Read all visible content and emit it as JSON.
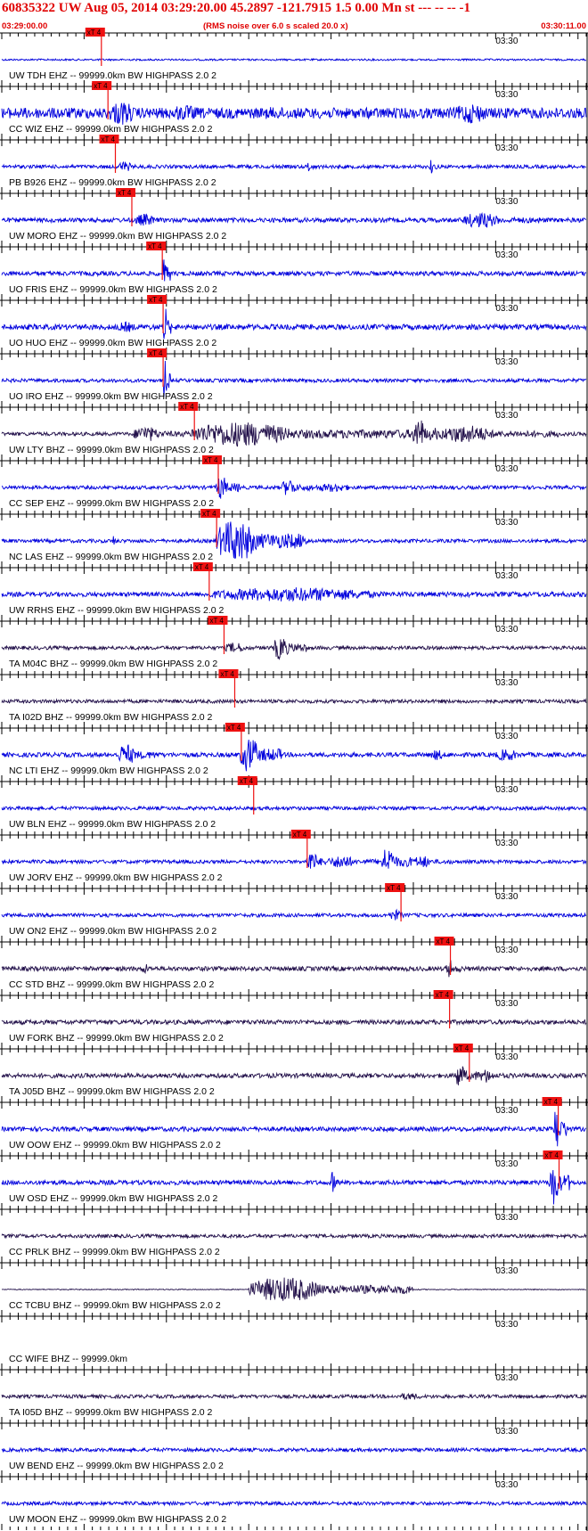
{
  "header": {
    "title": "60835322 UW Aug 05, 2014 03:29:20.00   45.2897 -121.7915  1.5 0.00 Mn st --- -- --   -1",
    "start_time": "03:29:00.00",
    "subtitle": "(RMS noise over 6.0 s scaled 20.0 x)",
    "end_time": "03:30:11.00"
  },
  "chart_data": {
    "type": "seismogram",
    "time_start_s": 0,
    "time_end_s": 71,
    "time_axis_label": "03:30",
    "time_axis_label_at_s": 60,
    "pick_label": "xT 4",
    "colors": {
      "blue": "#0000dd",
      "dark": "#22104a",
      "pick": "#ee1111"
    },
    "traces": [
      {
        "label": "UW TDH EHZ -- 99999.0km BW  HIGHPASS  2.0  2",
        "pick_s": 12.1,
        "color": "blue",
        "amp": 1,
        "bursts": []
      },
      {
        "label": "CC WIZ EHZ -- 99999.0km BW  HIGHPASS  2.0  2",
        "pick_s": 12.9,
        "color": "blue",
        "amp": 6,
        "bursts": [
          [
            13,
            20,
            14
          ],
          [
            20,
            30,
            9
          ],
          [
            30,
            45,
            7
          ],
          [
            55,
            64,
            12
          ]
        ]
      },
      {
        "label": "PB B926 EHZ -- 99999.0km BW  HIGHPASS  2.0  2",
        "pick_s": 13.8,
        "color": "blue",
        "amp": 2,
        "bursts": [
          [
            14,
            18,
            6
          ],
          [
            37,
            38,
            8
          ],
          [
            52,
            53,
            9
          ]
        ]
      },
      {
        "label": "UW MORO EHZ -- 99999.0km BW  HIGHPASS  2.0  2",
        "pick_s": 15.8,
        "color": "blue",
        "amp": 2.5,
        "bursts": [
          [
            16,
            22,
            7
          ],
          [
            56,
            66,
            9
          ]
        ]
      },
      {
        "label": "UO FRIS EHZ -- 99999.0km BW  HIGHPASS  2.0  2",
        "pick_s": 19.5,
        "color": "blue",
        "amp": 2.5,
        "bursts": [
          [
            19.5,
            20.5,
            24
          ]
        ]
      },
      {
        "label": "UO HUO EHZ -- 99999.0km BW  HIGHPASS  2.0  2",
        "pick_s": 19.6,
        "color": "blue",
        "amp": 3,
        "bursts": [
          [
            14,
            19,
            6
          ],
          [
            19.6,
            20.6,
            24
          ]
        ]
      },
      {
        "label": "UO IRO EHZ -- 99999.0km BW  HIGHPASS  2.0  2",
        "pick_s": 19.6,
        "color": "blue",
        "amp": 2,
        "bursts": [
          [
            19.6,
            20.6,
            24
          ]
        ]
      },
      {
        "label": "UW LTY BHZ -- 99999.0km BW  HIGHPASS  2.0  2",
        "pick_s": 23.4,
        "color": "dark",
        "amp": 2,
        "bursts": [
          [
            16,
            23,
            9
          ],
          [
            23,
            50,
            14
          ],
          [
            50,
            53,
            20
          ],
          [
            53,
            68,
            10
          ]
        ]
      },
      {
        "label": "CC SEP EHZ -- 99999.0km BW  HIGHPASS  2.0  2",
        "pick_s": 26.3,
        "color": "blue",
        "amp": 2,
        "bursts": [
          [
            26,
            29,
            14
          ],
          [
            34,
            38,
            10
          ],
          [
            38,
            48,
            5
          ]
        ]
      },
      {
        "label": "NC LAS EHZ -- 99999.0km BW  HIGHPASS  2.0  2",
        "pick_s": 26.1,
        "color": "blue",
        "amp": 2,
        "bursts": [
          [
            26,
            37,
            24
          ],
          [
            13.5,
            14,
            10
          ]
        ]
      },
      {
        "label": "UW RRHS EHZ -- 99999.0km BW  HIGHPASS  2.0  2",
        "pick_s": 25.2,
        "color": "blue",
        "amp": 2.5,
        "bursts": [
          [
            25,
            71,
            8
          ]
        ]
      },
      {
        "label": "TA M04C BHZ -- 99999.0km BW  HIGHPASS  2.0  2",
        "pick_s": 27.0,
        "color": "dark",
        "amp": 2,
        "bursts": [
          [
            27,
            33,
            6
          ],
          [
            33,
            37,
            14
          ]
        ]
      },
      {
        "label": "TA I02D BHZ -- 99999.0km BW  HIGHPASS  2.0  2",
        "pick_s": 28.3,
        "color": "dark",
        "amp": 2,
        "bursts": []
      },
      {
        "label": "NC LTI EHZ -- 99999.0km BW  HIGHPASS  2.0  2",
        "pick_s": 29.1,
        "color": "blue",
        "amp": 2.5,
        "bursts": [
          [
            14,
            19,
            12
          ],
          [
            29,
            34,
            20
          ],
          [
            52,
            56,
            6
          ],
          [
            60,
            66,
            7
          ]
        ]
      },
      {
        "label": "UW BLN EHZ -- 99999.0km BW  HIGHPASS  2.0  2",
        "pick_s": 30.6,
        "color": "blue",
        "amp": 2,
        "bursts": []
      },
      {
        "label": "UW JORV EHZ -- 99999.0km BW  HIGHPASS  2.0  2",
        "pick_s": 37.1,
        "color": "blue",
        "amp": 2,
        "bursts": [
          [
            37,
            40,
            12
          ],
          [
            40,
            46,
            8
          ],
          [
            46,
            50,
            16
          ],
          [
            50,
            55,
            7
          ]
        ]
      },
      {
        "label": "UW ON2 EHZ -- 99999.0km BW  HIGHPASS  2.0  2",
        "pick_s": 48.5,
        "color": "blue",
        "amp": 2,
        "bursts": [
          [
            47,
            51,
            6
          ]
        ]
      },
      {
        "label": "CC STD BHZ -- 99999.0km BW  HIGHPASS  2.0  2",
        "pick_s": 54.5,
        "color": "dark",
        "amp": 2.5,
        "bursts": [
          [
            17,
            19,
            6
          ],
          [
            54,
            56,
            10
          ]
        ]
      },
      {
        "label": "UW FORK BHZ -- 99999.0km BW  HIGHPASS  2.0  2",
        "pick_s": 54.4,
        "color": "dark",
        "amp": 2.5,
        "bursts": []
      },
      {
        "label": "TA J05D BHZ -- 99999.0km BW  HIGHPASS  2.0  2",
        "pick_s": 56.8,
        "color": "dark",
        "amp": 2.5,
        "bursts": [
          [
            55,
            58,
            14
          ],
          [
            58,
            62,
            8
          ]
        ]
      },
      {
        "label": "UW OOW EHZ -- 99999.0km BW  HIGHPASS  2.0  2",
        "pick_s": 67.6,
        "color": "blue",
        "amp": 2.5,
        "bursts": [
          [
            67,
            69,
            26
          ]
        ]
      },
      {
        "label": "UW OSD EHZ -- 99999.0km BW  HIGHPASS  2.0  2",
        "pick_s": 67.7,
        "color": "blue",
        "amp": 2.5,
        "bursts": [
          [
            40,
            41,
            14
          ],
          [
            66.5,
            69,
            26
          ]
        ]
      },
      {
        "label": "CC PRLK BHZ -- 99999.0km BW  HIGHPASS  2.0  2",
        "pick_s": null,
        "color": "dark",
        "amp": 2,
        "bursts": []
      },
      {
        "label": "CC TCBU BHZ -- 99999.0km BW  HIGHPASS  2.0  2",
        "pick_s": null,
        "color": "dark",
        "amp": 0.5,
        "bursts": [
          [
            30,
            50,
            14
          ]
        ]
      },
      {
        "label": "CC WIFE BHZ -- 99999.0km",
        "pick_s": null,
        "color": "dark",
        "amp": 0,
        "bursts": []
      },
      {
        "label": "TA I05D BHZ -- 99999.0km BW  HIGHPASS  2.0  2",
        "pick_s": null,
        "color": "dark",
        "amp": 2,
        "bursts": [
          [
            48,
            55,
            4
          ]
        ]
      },
      {
        "label": "UW BEND EHZ -- 99999.0km BW  HIGHPASS  2.0  2",
        "pick_s": null,
        "color": "blue",
        "amp": 2,
        "bursts": []
      },
      {
        "label": "UW MOON EHZ -- 99999.0km BW  HIGHPASS  2.0  2",
        "pick_s": null,
        "color": "blue",
        "amp": 2,
        "bursts": []
      }
    ]
  }
}
